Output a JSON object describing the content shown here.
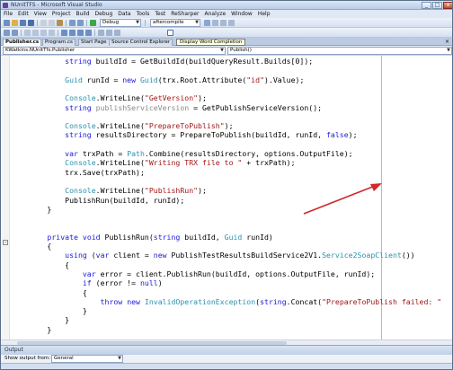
{
  "window": {
    "title": "NUnitTFS - Microsoft Visual Studio",
    "min": "_",
    "max": "□",
    "close": "x"
  },
  "menu": [
    "File",
    "Edit",
    "View",
    "Project",
    "Build",
    "Debug",
    "Data",
    "Tools",
    "Test",
    "ReSharper",
    "Analyze",
    "Window",
    "Help"
  ],
  "toolbar": {
    "config_combo": "Debug",
    "search_combo": "aftercompile"
  },
  "tooltip": "Display Word Completion",
  "tabs": [
    "Publisher.cs",
    "Program.cs",
    "Start Page",
    "Source Control Explorer"
  ],
  "navbar": {
    "type_combo": "KWatkins.NUnitTfs.Publisher",
    "member_combo": "Publish()"
  },
  "code": [
    [
      {
        "t": "            "
      },
      {
        "t": "string",
        "c": "kw"
      },
      {
        "t": " buildId = GetBuildId(buildQueryResult.Builds[0]);"
      }
    ],
    [
      {
        "t": ""
      }
    ],
    [
      {
        "t": "            "
      },
      {
        "t": "Guid",
        "c": "ty"
      },
      {
        "t": " runId = "
      },
      {
        "t": "new",
        "c": "kw"
      },
      {
        "t": " "
      },
      {
        "t": "Guid",
        "c": "ty"
      },
      {
        "t": "(trx.Root.Attribute("
      },
      {
        "t": "\"id\"",
        "c": "st"
      },
      {
        "t": ").Value);"
      }
    ],
    [
      {
        "t": ""
      }
    ],
    [
      {
        "t": "            "
      },
      {
        "t": "Console",
        "c": "ty"
      },
      {
        "t": ".WriteLine("
      },
      {
        "t": "\"GetVersion\"",
        "c": "st"
      },
      {
        "t": ");"
      }
    ],
    [
      {
        "t": "            "
      },
      {
        "t": "string",
        "c": "kw"
      },
      {
        "t": " "
      },
      {
        "t": "publishServiceVersion",
        "c": "gr"
      },
      {
        "t": " = GetPublishServiceVersion();"
      }
    ],
    [
      {
        "t": ""
      }
    ],
    [
      {
        "t": "            "
      },
      {
        "t": "Console",
        "c": "ty"
      },
      {
        "t": ".WriteLine("
      },
      {
        "t": "\"PrepareToPublish\"",
        "c": "st"
      },
      {
        "t": ");"
      }
    ],
    [
      {
        "t": "            "
      },
      {
        "t": "string",
        "c": "kw"
      },
      {
        "t": " resultsDirectory = PrepareToPublish(buildId, runId, "
      },
      {
        "t": "false",
        "c": "kw"
      },
      {
        "t": ");"
      }
    ],
    [
      {
        "t": ""
      }
    ],
    [
      {
        "t": "            "
      },
      {
        "t": "var",
        "c": "kw"
      },
      {
        "t": " trxPath = "
      },
      {
        "t": "Path",
        "c": "ty"
      },
      {
        "t": ".Combine(resultsDirectory, options.OutputFile);"
      }
    ],
    [
      {
        "t": "            "
      },
      {
        "t": "Console",
        "c": "ty"
      },
      {
        "t": ".WriteLine("
      },
      {
        "t": "\"Writing TRX file to \"",
        "c": "st"
      },
      {
        "t": " + trxPath);"
      }
    ],
    [
      {
        "t": "            trx.Save(trxPath);"
      }
    ],
    [
      {
        "t": ""
      }
    ],
    [
      {
        "t": "            "
      },
      {
        "t": "Console",
        "c": "ty"
      },
      {
        "t": ".WriteLine("
      },
      {
        "t": "\"PublishRun\"",
        "c": "st"
      },
      {
        "t": ");"
      }
    ],
    [
      {
        "t": "            PublishRun(buildId, runId);"
      }
    ],
    [
      {
        "t": "        }"
      }
    ],
    [
      {
        "t": ""
      }
    ],
    [
      {
        "t": ""
      }
    ],
    [
      {
        "t": "        "
      },
      {
        "t": "private",
        "c": "kw"
      },
      {
        "t": " "
      },
      {
        "t": "void",
        "c": "kw"
      },
      {
        "t": " PublishRun("
      },
      {
        "t": "string",
        "c": "kw"
      },
      {
        "t": " buildId, "
      },
      {
        "t": "Guid",
        "c": "ty"
      },
      {
        "t": " runId)"
      }
    ],
    [
      {
        "t": "        {"
      }
    ],
    [
      {
        "t": "            "
      },
      {
        "t": "using",
        "c": "kw"
      },
      {
        "t": " ("
      },
      {
        "t": "var",
        "c": "kw"
      },
      {
        "t": " client = "
      },
      {
        "t": "new",
        "c": "kw"
      },
      {
        "t": " PublishTestResultsBuildService2V1."
      },
      {
        "t": "Service2SoapClient",
        "c": "ty"
      },
      {
        "t": "())"
      }
    ],
    [
      {
        "t": "            {"
      }
    ],
    [
      {
        "t": "                "
      },
      {
        "t": "var",
        "c": "kw"
      },
      {
        "t": " error = client.PublishRun(buildId, options.OutputFile, runId);"
      }
    ],
    [
      {
        "t": "                "
      },
      {
        "t": "if",
        "c": "kw"
      },
      {
        "t": " (error != "
      },
      {
        "t": "null",
        "c": "kw"
      },
      {
        "t": ")"
      }
    ],
    [
      {
        "t": "                {"
      }
    ],
    [
      {
        "t": "                    "
      },
      {
        "t": "throw",
        "c": "kw"
      },
      {
        "t": " "
      },
      {
        "t": "new",
        "c": "kw"
      },
      {
        "t": " "
      },
      {
        "t": "InvalidOperationException",
        "c": "ty"
      },
      {
        "t": "("
      },
      {
        "t": "string",
        "c": "kw"
      },
      {
        "t": ".Concat("
      },
      {
        "t": "\"PrepareToPublish failed: \"",
        "c": "st"
      }
    ],
    [
      {
        "t": "                }"
      }
    ],
    [
      {
        "t": "            }"
      }
    ],
    [
      {
        "t": "        }"
      }
    ]
  ],
  "output": {
    "title": "Output",
    "show_label": "Show output from:",
    "source_combo": "General"
  },
  "colors": {
    "keyword": "#1a1ad6",
    "type": "#2b91af",
    "string": "#a31515",
    "arrow": "#d0282a"
  }
}
